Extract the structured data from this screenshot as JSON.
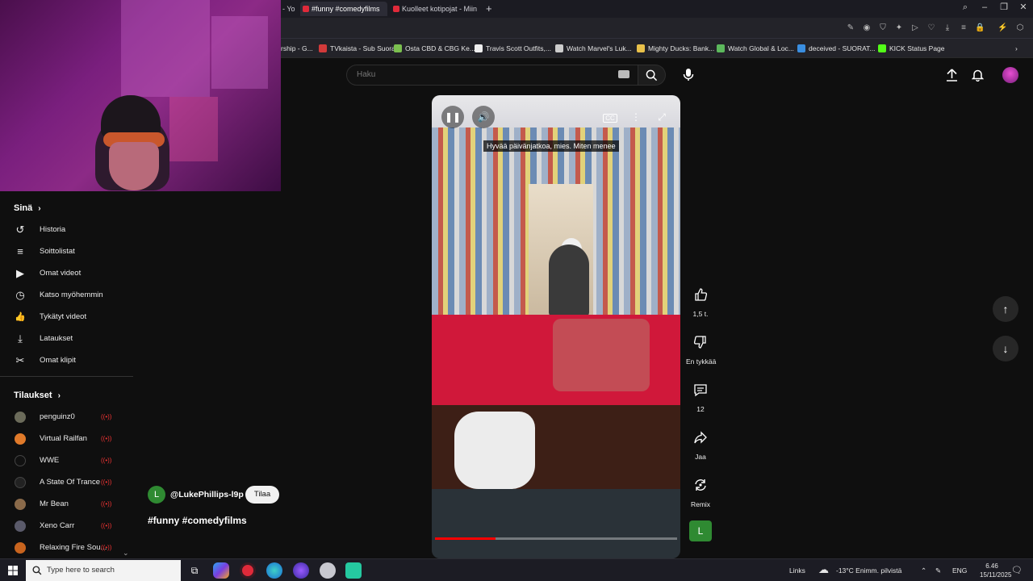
{
  "browser": {
    "tabs": [
      {
        "label": "- Yo"
      },
      {
        "label": "#funny #comedyfilms"
      },
      {
        "label": "Kuolleet kotipojat - Miin"
      }
    ],
    "new_tab": "+",
    "bookmarks": [
      {
        "label": "rship - G...",
        "color": "#3a74c9"
      },
      {
        "label": "TVkaista - Sub Suora",
        "color": "#d23a3a"
      },
      {
        "label": "Osta CBD & CBG Ke...",
        "color": "#7bbf4f"
      },
      {
        "label": "Travis Scott Outfits,...",
        "color": "#eeeeee"
      },
      {
        "label": "Watch Marvel's Luk...",
        "color": "#cccccc"
      },
      {
        "label": "Mighty Ducks: Bank...",
        "color": "#e8c04a"
      },
      {
        "label": "Watch Global & Loc...",
        "color": "#5cb85c"
      },
      {
        "label": "deceived - SUORAT...",
        "color": "#3a8ee0"
      },
      {
        "label": "KICK Status Page",
        "color": "#53fc18"
      }
    ]
  },
  "sidebar": {
    "you_title": "Sinä",
    "you_items": [
      {
        "label": "Historia",
        "icon": "history-icon",
        "glyph": "↺"
      },
      {
        "label": "Soittolistat",
        "icon": "playlists-icon",
        "glyph": "≡"
      },
      {
        "label": "Omat videot",
        "icon": "your-videos-icon",
        "glyph": "▶"
      },
      {
        "label": "Katso myöhemmin",
        "icon": "watch-later-icon",
        "glyph": "◷"
      },
      {
        "label": "Tykätyt videot",
        "icon": "liked-videos-icon",
        "glyph": "👍"
      },
      {
        "label": "Lataukset",
        "icon": "downloads-icon",
        "glyph": "⤓"
      },
      {
        "label": "Omat klipit",
        "icon": "clips-icon",
        "glyph": "✂"
      }
    ],
    "subs_title": "Tilaukset",
    "subscriptions": [
      {
        "label": "penguinz0",
        "color": "#6b6b5a"
      },
      {
        "label": "Virtual Railfan",
        "color": "#e07a2a"
      },
      {
        "label": "WWE",
        "color": "#111111"
      },
      {
        "label": "A State Of Trance",
        "color": "#222222"
      },
      {
        "label": "Mr Bean",
        "color": "#8a6a4a"
      },
      {
        "label": "Xeno Carr",
        "color": "#5a5a6a"
      },
      {
        "label": "Relaxing Fire Sou...",
        "color": "#c8641e"
      }
    ]
  },
  "header": {
    "search_placeholder": "Haku"
  },
  "video": {
    "caption": "Hyvää päivänjatkoa, mies. Miten menee",
    "progress": 0.25
  },
  "actions": {
    "likes": "1,5 t.",
    "dislike": "En tykkää",
    "comments": "12",
    "share": "Jaa",
    "remix": "Remix"
  },
  "channel": {
    "avatar_letter": "L",
    "name": "@LukePhillips-l9p",
    "subscribe": "Tilaa",
    "title": "#funny #comedyfilms"
  },
  "taskbar": {
    "search_placeholder": "Type here to search",
    "links": "Links",
    "weather": "-13°C  Enimm. pilvistä",
    "lang": "ENG",
    "time": "6.46",
    "date": "15/11/2025"
  }
}
